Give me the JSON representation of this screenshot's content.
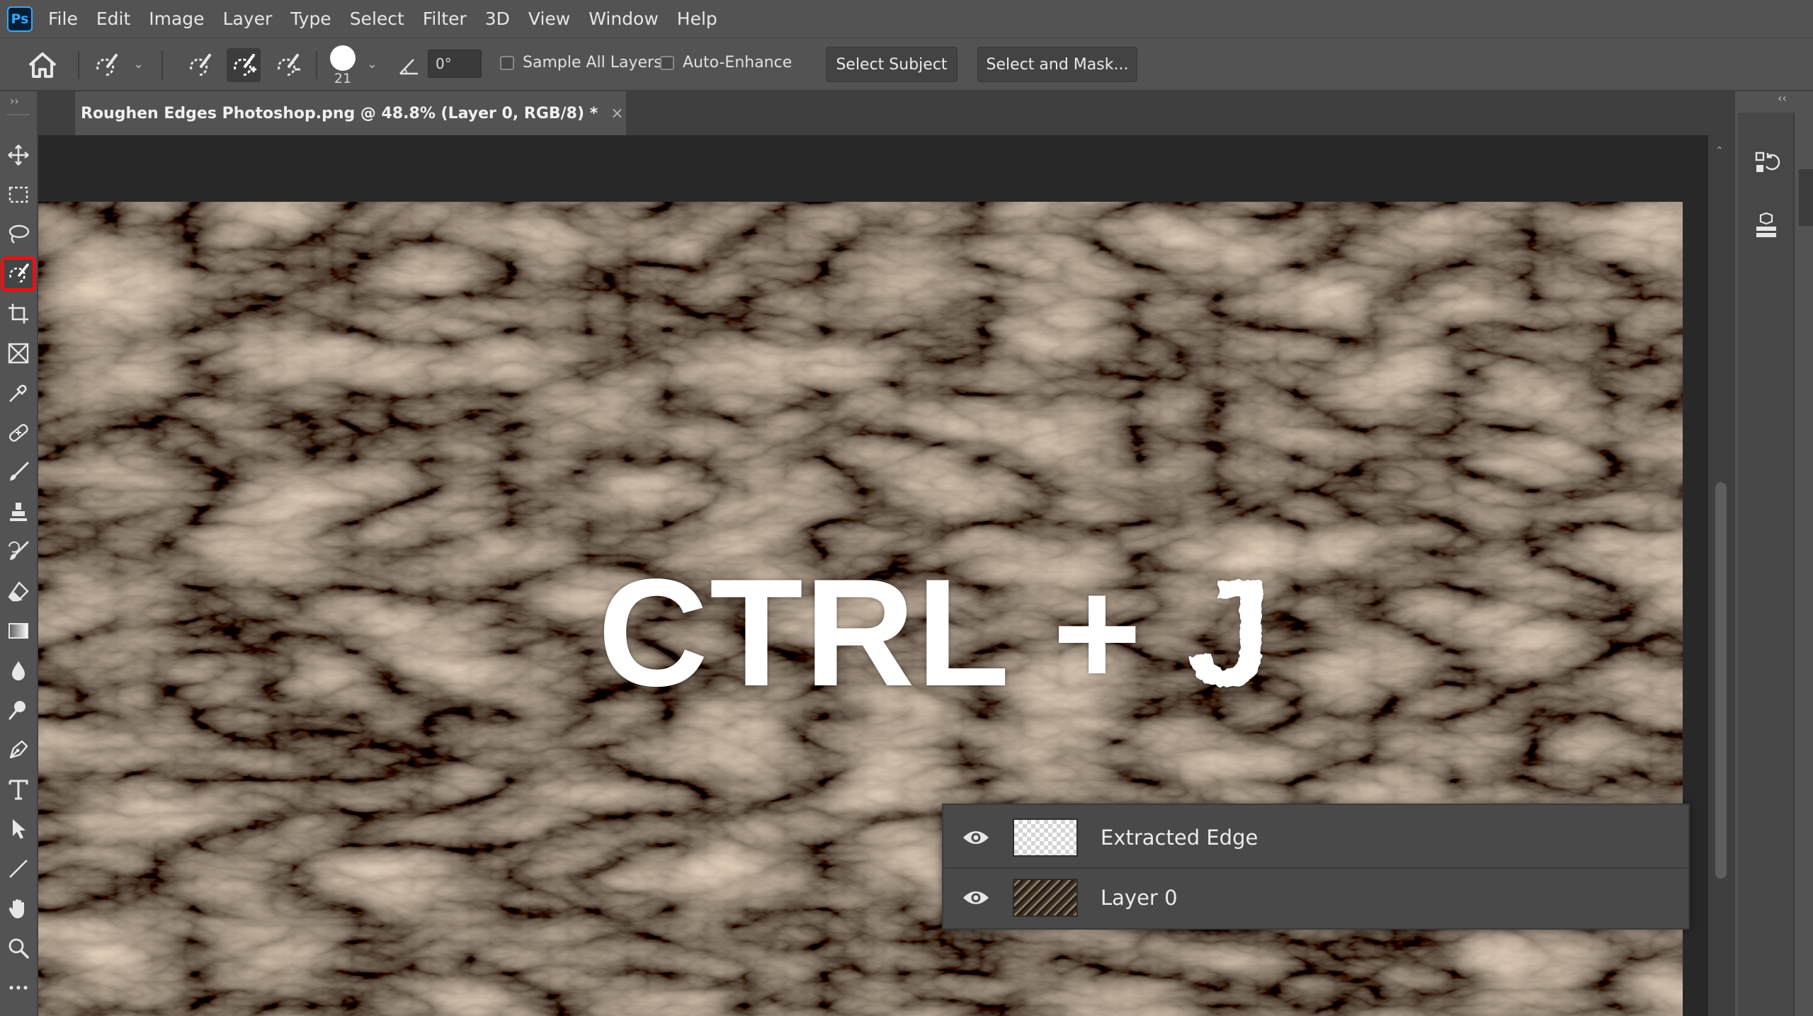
{
  "menu": {
    "app_icon": "Ps",
    "items": [
      "File",
      "Edit",
      "Image",
      "Layer",
      "Type",
      "Select",
      "Filter",
      "3D",
      "View",
      "Window",
      "Help"
    ]
  },
  "options": {
    "brush_size": "21",
    "angle_value": "0°",
    "sample_all_layers": "Sample All Layers",
    "auto_enhance": "Auto-Enhance",
    "select_subject": "Select Subject",
    "select_and_mask": "Select and Mask..."
  },
  "document": {
    "tab_title": "Roughen Edges Photoshop.png @ 48.8% (Layer 0, RGB/8) *",
    "close_glyph": "×"
  },
  "canvas": {
    "overlay_main": "CTRL + ",
    "overlay_rough": "J"
  },
  "layers": [
    {
      "name": "Extracted Edge",
      "thumb": "transparent-checker"
    },
    {
      "name": "Layer 0",
      "thumb": "rock-texture"
    }
  ],
  "colors": {
    "ui_bg": "#535353",
    "pasteboard": "#282828",
    "ps_brand": "#31a8ff",
    "highlight": "#e0141b"
  }
}
